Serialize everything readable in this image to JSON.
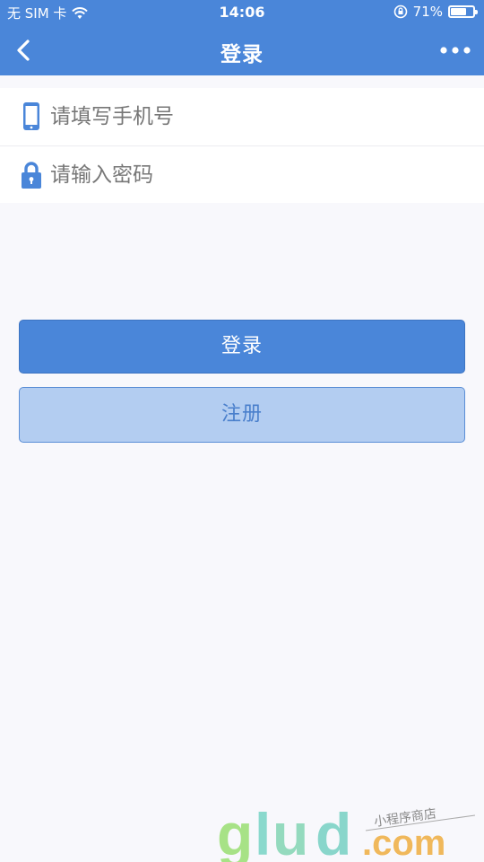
{
  "status_bar": {
    "carrier": "无 SIM 卡",
    "time": "14:06",
    "battery_percent_label": "71%",
    "battery_level": 0.71
  },
  "nav": {
    "title": "登录"
  },
  "form": {
    "phone_placeholder": "请填写手机号",
    "password_placeholder": "请输入密码"
  },
  "buttons": {
    "login_label": "登录",
    "register_label": "注册"
  },
  "watermark": {
    "logo": "glud.com",
    "tagline": "小程序商店"
  },
  "colors": {
    "brand": "#4a86d9",
    "register_bg": "#b3cdf1",
    "page_bg": "#f8f8fc"
  }
}
